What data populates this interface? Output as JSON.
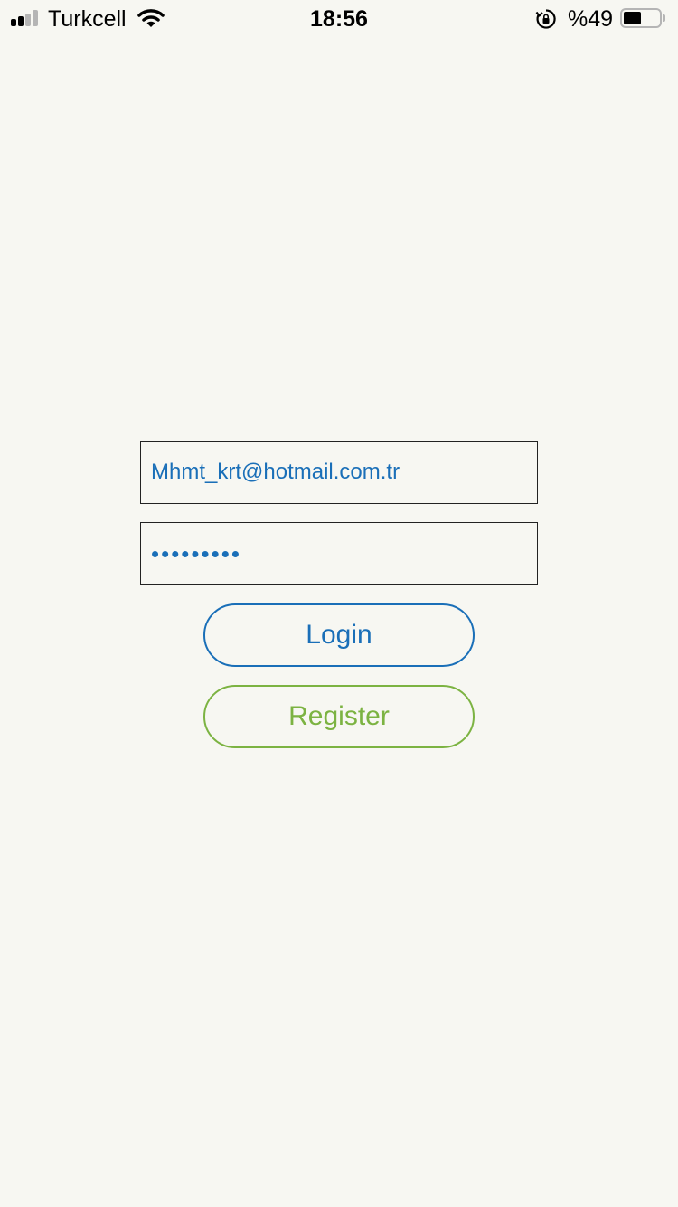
{
  "status_bar": {
    "carrier": "Turkcell",
    "time": "18:56",
    "battery_percent_label": "%49",
    "battery_level": 0.49,
    "signal_bars_filled": 2,
    "signal_bars_total": 4,
    "icons": [
      "signal-icon",
      "wifi-icon",
      "rotation-lock-icon",
      "battery-icon"
    ]
  },
  "login_form": {
    "email_value": "Mhmt_krt@hotmail.com.tr",
    "password_value": "•••••••••",
    "login_label": "Login",
    "register_label": "Register"
  },
  "colors": {
    "background": "#f7f7f2",
    "primary_blue": "#1a6fb8",
    "register_green": "#7cb342"
  }
}
